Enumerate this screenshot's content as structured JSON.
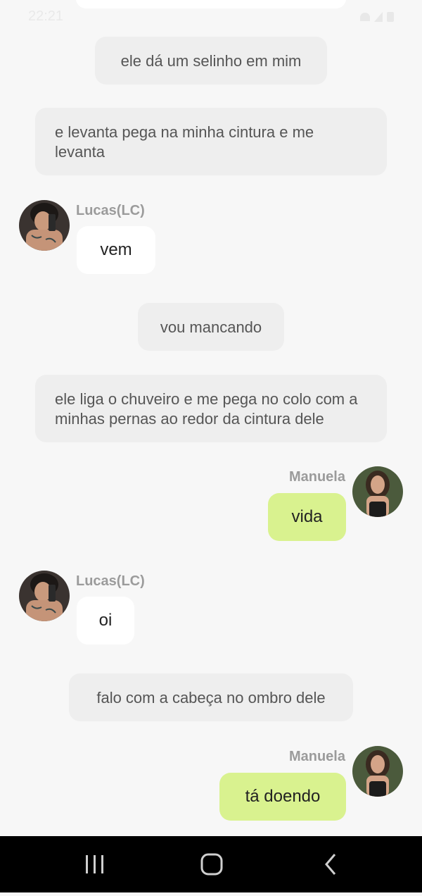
{
  "status": {
    "time": "22:21"
  },
  "messages": {
    "m1": "ele dá um selinho em mim",
    "m2": "e levanta pega na minha cintura e me levanta",
    "m3_name": "Lucas(LC)",
    "m3_text": "vem",
    "m4": "vou mancando",
    "m5": "ele liga o chuveiro e me pega no colo com a minhas pernas ao redor da cintura dele",
    "m6_name": "Manuela",
    "m6_text": "vida",
    "m7_name": "Lucas(LC)",
    "m7_text": "oi",
    "m8": "falo com a cabeça no ombro dele",
    "m9_name": "Manuela",
    "m9_text": "tá doendo"
  },
  "colors": {
    "background": "#f7f7f7",
    "narration_bg": "#eeeeee",
    "incoming_bg": "#ffffff",
    "outgoing_bg": "#d9f28f",
    "nav_bar": "#000000"
  },
  "icons": {
    "nav_recent": "recent-apps-icon",
    "nav_home": "home-icon",
    "nav_back": "back-icon"
  }
}
